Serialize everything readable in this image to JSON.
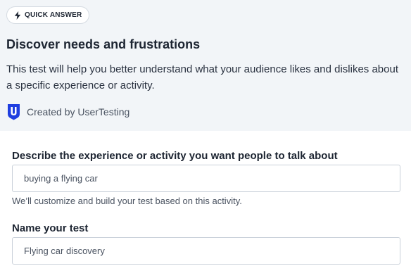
{
  "badge": {
    "label": "QUICK ANSWER",
    "icon": "lightning-bolt-icon"
  },
  "header": {
    "title": "Discover needs and frustrations",
    "description": "This test will help you better understand what your audience likes and dislikes about a specific experience or activity.",
    "creator": "Created by UserTesting",
    "creator_logo": "usertesting-logo",
    "logo_color": "#1f3ee0"
  },
  "form": {
    "activity": {
      "label": "Describe the experience or activity you want people to talk about",
      "value": "buying a flying car",
      "help": "We’ll customize and build your test based on this activity."
    },
    "name": {
      "label": "Name your test",
      "value": "Flying car discovery"
    }
  }
}
